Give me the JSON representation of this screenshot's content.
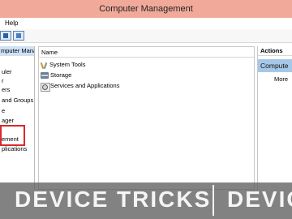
{
  "window": {
    "title": "Computer Management"
  },
  "menubar": {
    "items": [
      "Help"
    ]
  },
  "left_pane": {
    "header": "mputer Management (Local",
    "tree_items": [
      "uler",
      "r",
      "ers",
      "and Groups",
      "e",
      "ager",
      "ement",
      "plications"
    ]
  },
  "middle_pane": {
    "column_header": "Name",
    "rows": [
      {
        "label": "System Tools",
        "icon": "tools-icon"
      },
      {
        "label": "Storage",
        "icon": "storage-icon"
      },
      {
        "label": "Services and Applications",
        "icon": "services-icon"
      }
    ]
  },
  "actions_pane": {
    "header": "Actions",
    "selected": "Compute",
    "more": "More"
  },
  "watermark": {
    "text1": "DEVICE TRICKS",
    "text2": "DEVIC"
  },
  "colors": {
    "titlebar": "#f1aa9a",
    "left_header": "#cfe1f5",
    "actions_selected": "#a6c8e8",
    "highlight_box": "#d9292b"
  }
}
